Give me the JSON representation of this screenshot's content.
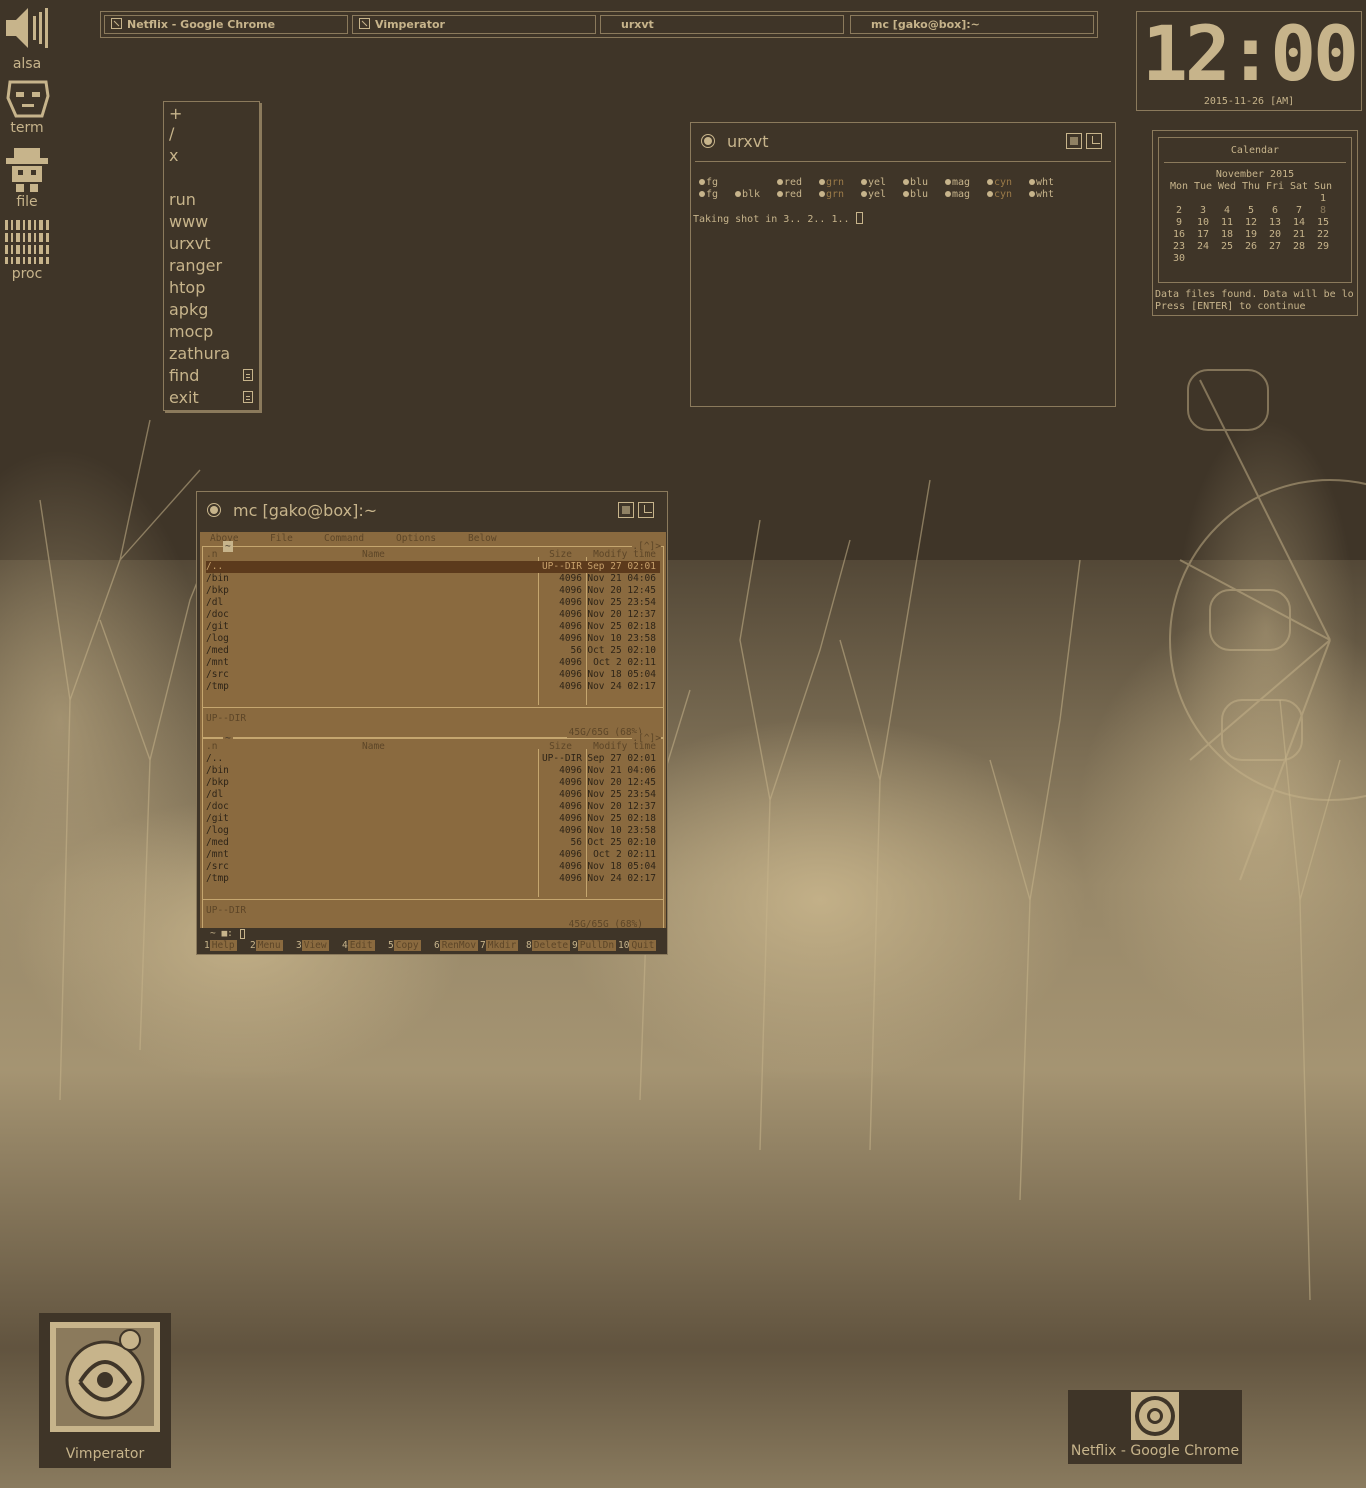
{
  "taskbar": {
    "tasks": [
      {
        "label": "Netflix - Google Chrome"
      },
      {
        "label": "Vimperator"
      },
      {
        "label": "urxvt"
      },
      {
        "label": "mc [gako@box]:~"
      }
    ]
  },
  "launcher": {
    "items": [
      {
        "label": "alsa",
        "icon": "speaker-icon"
      },
      {
        "label": "term",
        "icon": "terminal-face-icon"
      },
      {
        "label": "file",
        "icon": "file-manager-icon"
      },
      {
        "label": "proc",
        "icon": "process-icon"
      }
    ]
  },
  "menu": {
    "items": [
      "+",
      "/",
      "x",
      "run",
      "www",
      "urxvt",
      "ranger",
      "htop",
      "apkg",
      "mocp",
      "zathura",
      "find",
      "exit"
    ]
  },
  "clock": {
    "time": "12:00",
    "date": "2015-11-26 [AM]"
  },
  "calendar": {
    "title": "Calendar",
    "month": "November 2015",
    "weekdays": [
      "Mon",
      "Tue",
      "Wed",
      "Thu",
      "Fri",
      "Sat",
      "Sun"
    ],
    "days": [
      "",
      "",
      "",
      "",
      "",
      "",
      "1",
      "2",
      "3",
      "4",
      "5",
      "6",
      "7",
      "8",
      "9",
      "10",
      "11",
      "12",
      "13",
      "14",
      "15",
      "16",
      "17",
      "18",
      "19",
      "20",
      "21",
      "22",
      "23",
      "24",
      "25",
      "26",
      "27",
      "28",
      "29",
      "30"
    ],
    "message_line1": "Data files found. Data will be lo",
    "message_line2": "Press [ENTER] to continue"
  },
  "urxvt": {
    "title": "urxvt",
    "colors_row1": [
      "fg",
      "red",
      "grn",
      "yel",
      "blu",
      "mag",
      "cyn",
      "wht"
    ],
    "colors_row2": [
      "fg",
      "blk",
      "red",
      "grn",
      "yel",
      "blu",
      "mag",
      "cyn",
      "wht"
    ],
    "shot_line": "Taking shot in 3.. 2.. 1.. "
  },
  "mc": {
    "title": "mc [gako@box]:~",
    "menubar": [
      "Above",
      "File",
      "Command",
      "Options",
      "Below"
    ],
    "panel_path": "~",
    "columns": {
      "n": ".n",
      "name": "Name",
      "size": "Size",
      "time": "Modify time"
    },
    "corner": ".[^]>",
    "files": [
      {
        "name": "/..",
        "size": "UP--DIR",
        "time": "Sep 27 02:01"
      },
      {
        "name": "/bin",
        "size": "4096",
        "time": "Nov 21 04:06"
      },
      {
        "name": "/bkp",
        "size": "4096",
        "time": "Nov 20 12:45"
      },
      {
        "name": "/dl",
        "size": "4096",
        "time": "Nov 25 23:54"
      },
      {
        "name": "/doc",
        "size": "4096",
        "time": "Nov 20 12:37"
      },
      {
        "name": "/git",
        "size": "4096",
        "time": "Nov 25 02:18"
      },
      {
        "name": "/log",
        "size": "4096",
        "time": "Nov 10 23:58"
      },
      {
        "name": "/med",
        "size": "56",
        "time": "Oct 25 02:10"
      },
      {
        "name": "/mnt",
        "size": "4096",
        "time": "Oct  2 02:11"
      },
      {
        "name": "/src",
        "size": "4096",
        "time": "Nov 18 05:04"
      },
      {
        "name": "/tmp",
        "size": "4096",
        "time": "Nov 24 02:17"
      }
    ],
    "status": "UP--DIR",
    "disk": "45G/65G (68%)",
    "prompt": "~ ■:",
    "fkeys": [
      {
        "n": "1",
        "label": "Help"
      },
      {
        "n": "2",
        "label": "Menu"
      },
      {
        "n": "3",
        "label": "View"
      },
      {
        "n": "4",
        "label": "Edit"
      },
      {
        "n": "5",
        "label": "Copy"
      },
      {
        "n": "6",
        "label": "RenMov"
      },
      {
        "n": "7",
        "label": "Mkdir"
      },
      {
        "n": "8",
        "label": "Delete"
      },
      {
        "n": "9",
        "label": "PullDn"
      },
      {
        "n": "10",
        "label": "Quit"
      }
    ]
  },
  "desktop": {
    "vimperator": "Vimperator",
    "chrome": "Netflix - Google Chrome"
  },
  "colors": {
    "bg": "#3f3528",
    "fg": "#c7b48b",
    "border": "#8b7a5c",
    "mc_panel": "#8a6a3f"
  }
}
